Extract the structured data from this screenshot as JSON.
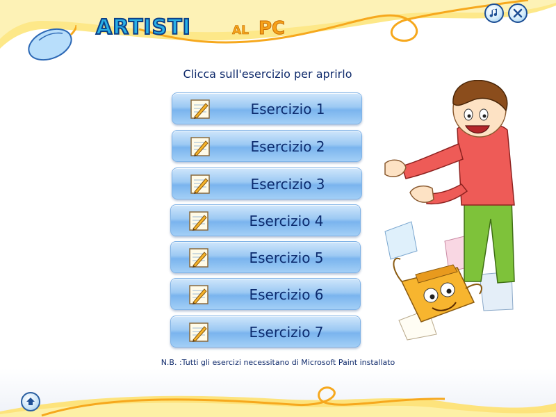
{
  "header": {
    "title_main": "ARTISTI",
    "title_al": "AL",
    "title_pc": "PC"
  },
  "controls": {
    "music_icon": "music-note-icon",
    "close_icon": "close-icon",
    "home_icon": "home-arrow-icon"
  },
  "main": {
    "instruction": "Clicca sull'esercizio per aprirlo",
    "exercises": [
      {
        "label": "Esercizio 1"
      },
      {
        "label": "Esercizio 2"
      },
      {
        "label": "Esercizio 3"
      },
      {
        "label": "Esercizio 4"
      },
      {
        "label": "Esercizio 5"
      },
      {
        "label": "Esercizio 6"
      },
      {
        "label": "Esercizio 7"
      }
    ],
    "note": "N.B. :Tutti gli esercizi necessitano di Microsoft Paint installato"
  },
  "colors": {
    "title_blue": "#2ab0e6",
    "title_orange": "#f7a21a",
    "button_blue": "#9cc9f3",
    "text_navy": "#0f2a6b",
    "background_yellow": "#fde27a"
  }
}
